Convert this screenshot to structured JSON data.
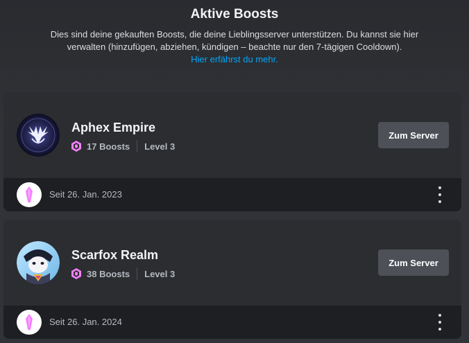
{
  "header": {
    "title": "Aktive Boosts",
    "description": "Dies sind deine gekauften Boosts, die deine Lieblingsserver unterstützen. Du kannst sie hier verwalten (hinzufügen, abziehen, kündigen – beachte nur den 7-tägigen Cooldown).",
    "learn_more": "Hier erfährst du mehr."
  },
  "servers": [
    {
      "name": "Aphex Empire",
      "boosts": "17 Boosts",
      "level": "Level 3",
      "button_label": "Zum Server",
      "since": "Seit 26. Jan. 2023"
    },
    {
      "name": "Scarfox Realm",
      "boosts": "38 Boosts",
      "level": "Level 3",
      "button_label": "Zum Server",
      "since": "Seit 26. Jan. 2024"
    }
  ],
  "colors": {
    "accent_link": "#00a8fc",
    "boost_pink": "#f47fff",
    "button_bg": "#4e5058"
  },
  "icons": {
    "boost": "boost-gem-icon",
    "more": "more-vertical-icon"
  }
}
